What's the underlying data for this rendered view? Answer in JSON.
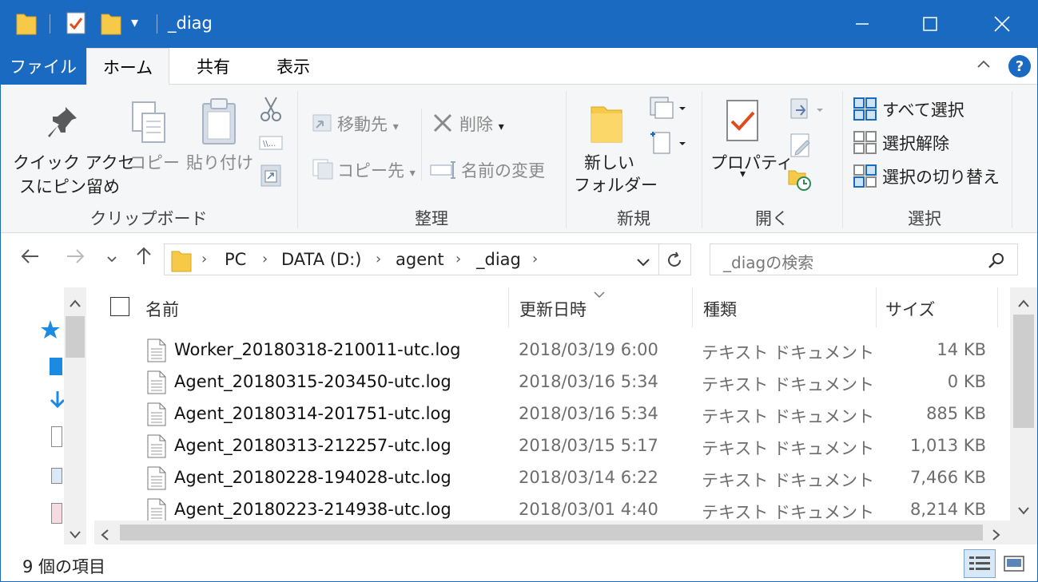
{
  "window": {
    "title": "_diag",
    "minimize_label": "—",
    "maximize_label": "☐",
    "close_label": "✕"
  },
  "quick_access": {
    "dropdown_glyph": "▾"
  },
  "tabs": {
    "file": "ファイル",
    "home": "ホーム",
    "share": "共有",
    "view": "表示"
  },
  "ribbon": {
    "clipboard": {
      "pin_label_1": "クイック アクセ",
      "pin_label_2": "スにピン留め",
      "copy_label": "コピー",
      "paste_label": "貼り付け",
      "group_label": "クリップボード"
    },
    "organize": {
      "move_to": "移動先",
      "copy_to": "コピー先",
      "delete": "削除",
      "rename": "名前の変更",
      "group_label": "整理"
    },
    "new": {
      "new_folder_1": "新しい",
      "new_folder_2": "フォルダー",
      "group_label": "新規"
    },
    "open": {
      "properties": "プロパティ",
      "group_label": "開く"
    },
    "select": {
      "select_all": "すべて選択",
      "select_none": "選択解除",
      "invert": "選択の切り替え",
      "group_label": "選択"
    },
    "collapse_glyph": "^",
    "help_glyph": "?"
  },
  "address": {
    "back": "←",
    "forward": "→",
    "recent": "⌄",
    "up": "↑",
    "crumbs": [
      "PC",
      "DATA (D:)",
      "agent",
      "_diag"
    ],
    "sep": "›",
    "refresh": "↻",
    "dropdown": "⌄"
  },
  "search": {
    "placeholder": "_diagの検索"
  },
  "columns": {
    "name": "名前",
    "date": "更新日時",
    "type": "種類",
    "size": "サイズ"
  },
  "files": [
    {
      "name": "Worker_20180318-210011-utc.log",
      "date": "2018/03/19 6:00",
      "type": "テキスト ドキュメント",
      "size": "14 KB"
    },
    {
      "name": "Agent_20180315-203450-utc.log",
      "date": "2018/03/16 5:34",
      "type": "テキスト ドキュメント",
      "size": "0 KB"
    },
    {
      "name": "Agent_20180314-201751-utc.log",
      "date": "2018/03/16 5:34",
      "type": "テキスト ドキュメント",
      "size": "885 KB"
    },
    {
      "name": "Agent_20180313-212257-utc.log",
      "date": "2018/03/15 5:17",
      "type": "テキスト ドキュメント",
      "size": "1,013 KB"
    },
    {
      "name": "Agent_20180228-194028-utc.log",
      "date": "2018/03/14 6:22",
      "type": "テキスト ドキュメント",
      "size": "7,466 KB"
    },
    {
      "name": "Agent_20180223-214938-utc.log",
      "date": "2018/03/01 4:40",
      "type": "テキスト ドキュメント",
      "size": "8,214 KB"
    }
  ],
  "status": {
    "count": "9 個の項目"
  },
  "colors": {
    "accent": "#1b6ac2",
    "ribbon_bg": "#f5f6f7",
    "folder": "#f7c948"
  }
}
